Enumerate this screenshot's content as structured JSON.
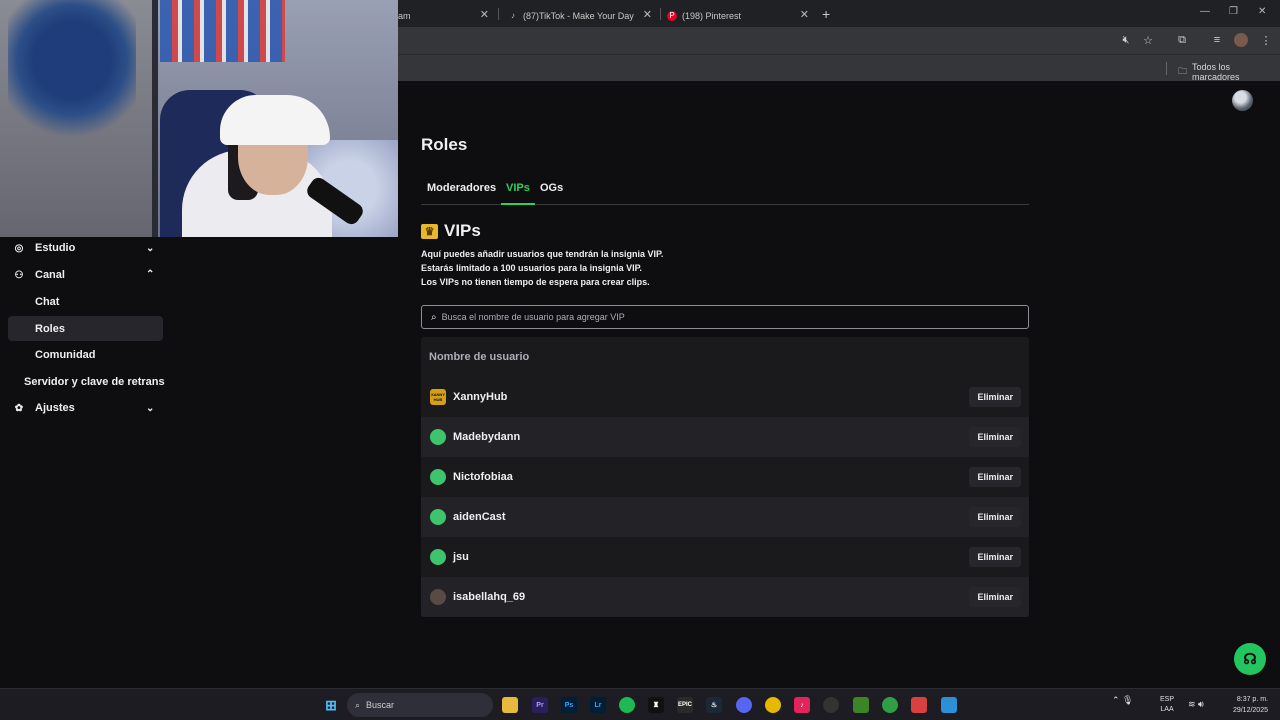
{
  "browser": {
    "tabs": [
      {
        "label": "ram",
        "favicon": "instagram-icon"
      },
      {
        "label": "(87)TikTok - Make Your Day",
        "favicon": "tiktok-icon"
      },
      {
        "label": "(198) Pinterest",
        "favicon": "pinterest-icon"
      }
    ],
    "new_tab": "+",
    "bookmarks_all": "Todos los marcadores"
  },
  "sidebar": {
    "items": [
      {
        "label": "Estudio",
        "icon": "studio-icon",
        "chevron": "⌄"
      },
      {
        "label": "Canal",
        "icon": "channel-icon",
        "chevron": "⌃"
      },
      {
        "label": "Chat"
      },
      {
        "label": "Roles"
      },
      {
        "label": "Comunidad"
      },
      {
        "label": "Servidor y clave de retrans"
      },
      {
        "label": "Ajustes",
        "icon": "gear-icon",
        "chevron": "⌄"
      }
    ]
  },
  "main": {
    "title": "Roles",
    "tabs": [
      "Moderadores",
      "VIPs",
      "OGs"
    ],
    "active_tab": "VIPs",
    "section_title": "VIPs",
    "description": [
      "Aquí puedes añadir usuarios que tendrán la insignia VIP.",
      "Estarás limitado a 100 usuarios para la insignia VIP.",
      "Los VIPs no tienen tiempo de espera para crear clips."
    ],
    "search_placeholder": "Busca el nombre de usuario para agregar VIP",
    "column_header": "Nombre de usuario",
    "remove_label": "Eliminar",
    "users": [
      {
        "name": "XannyHub",
        "avatar_text": "XANNY HUB",
        "avatar_color": "#d4a017"
      },
      {
        "name": "Madebydann",
        "avatar_color": "#3ec46d"
      },
      {
        "name": "Nictofobiaa",
        "avatar_color": "#3ec46d"
      },
      {
        "name": "aidenCast",
        "avatar_color": "#3ec46d"
      },
      {
        "name": "jsu",
        "avatar_color": "#3ec46d"
      },
      {
        "name": "isabellahq_69",
        "avatar_color": "#5a4a44"
      }
    ]
  },
  "taskbar": {
    "search_label": "Buscar",
    "lang": "ESP",
    "lang_sub": "LAA",
    "time": "8:37 p. m.",
    "date": "29/12/2025"
  },
  "colors": {
    "accent": "#2ad15b",
    "help_button": "#22c55e"
  }
}
